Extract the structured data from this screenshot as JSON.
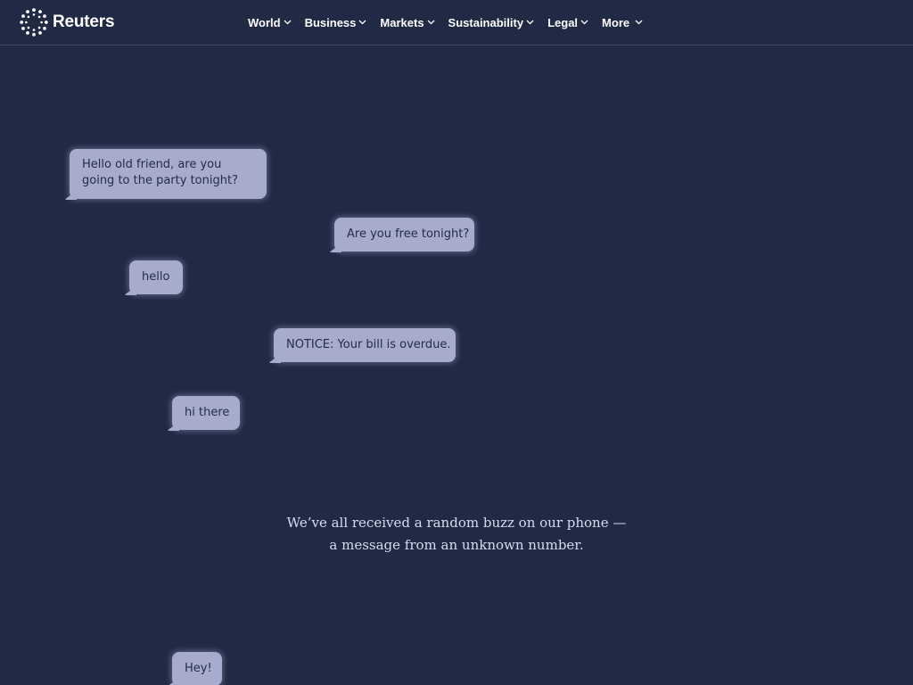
{
  "header": {
    "brand": "Reuters",
    "nav": [
      {
        "label": "World",
        "icon": "chevron-down-icon"
      },
      {
        "label": "Business",
        "icon": "chevron-down-icon"
      },
      {
        "label": "Markets",
        "icon": "chevron-down-icon"
      },
      {
        "label": "Sustainability",
        "icon": "chevron-down-icon"
      },
      {
        "label": "Legal",
        "icon": "chevron-down-icon"
      },
      {
        "label": "More",
        "icon": "chevron-down-icon"
      }
    ]
  },
  "messages": [
    {
      "text": "Hello old friend, are you going to the party tonight?"
    },
    {
      "text": "Are you free tonight?"
    },
    {
      "text": "hello"
    },
    {
      "text": "NOTICE: Your bill is overdue."
    },
    {
      "text": "hi there"
    },
    {
      "text": "Hey!"
    }
  ],
  "intro": {
    "line1": "We’ve all received a random buzz on our phone —",
    "line2": "a message from an unknown number."
  },
  "colors": {
    "background": "#212a45",
    "bubble": "#a7acce",
    "bubble_text": "#252c4a",
    "nav_text": "#ffffff",
    "intro_text": "#d7dbef"
  }
}
